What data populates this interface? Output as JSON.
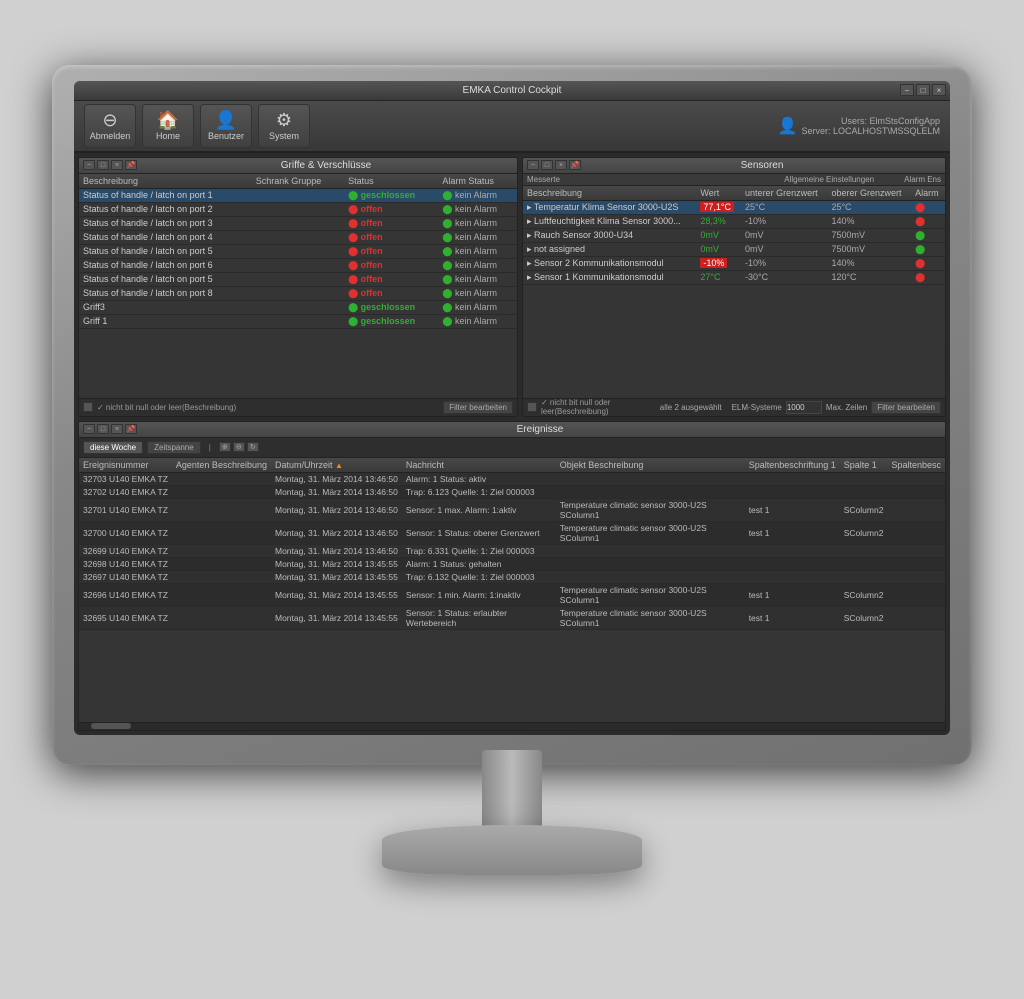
{
  "app": {
    "title": "EMKA Control Cockpit",
    "window_controls": [
      "-",
      "□",
      "×"
    ]
  },
  "toolbar": {
    "buttons": [
      {
        "label": "Abmelden",
        "icon": "⊖"
      },
      {
        "label": "Home",
        "icon": "🏠"
      },
      {
        "label": "Benutzer",
        "icon": "👤"
      },
      {
        "label": "System",
        "icon": "⚙"
      }
    ],
    "user": {
      "name": "Users: ElmStsConfigApp",
      "server": "Server: LOCALHOST\\MSSQLELM"
    }
  },
  "griffe_panel": {
    "title": "Griffe & Verschlüsse",
    "columns": [
      "Beschreibung",
      "Schrank Gruppe",
      "Status",
      "Alarm Status"
    ],
    "rows": [
      {
        "beschreibung": "Status of handle / latch on port 1",
        "status": "geschlossen",
        "status_type": "green",
        "alarm": "kein Alarm",
        "alarm_type": "green"
      },
      {
        "beschreibung": "Status of handle / latch on port 2",
        "status": "offen",
        "status_type": "red",
        "alarm": "kein Alarm",
        "alarm_type": "green"
      },
      {
        "beschreibung": "Status of handle / latch on port 3",
        "status": "offen",
        "status_type": "red",
        "alarm": "kein Alarm",
        "alarm_type": "green"
      },
      {
        "beschreibung": "Status of handle / latch on port 4",
        "status": "offen",
        "status_type": "red",
        "alarm": "kein Alarm",
        "alarm_type": "green"
      },
      {
        "beschreibung": "Status of handle / latch on port 5",
        "status": "offen",
        "status_type": "red",
        "alarm": "kein Alarm",
        "alarm_type": "green"
      },
      {
        "beschreibung": "Status of handle / latch on port 6",
        "status": "offen",
        "status_type": "red",
        "alarm": "kein Alarm",
        "alarm_type": "green"
      },
      {
        "beschreibung": "Status of handle / latch on port 5",
        "status": "offen",
        "status_type": "red",
        "alarm": "kein Alarm",
        "alarm_type": "green"
      },
      {
        "beschreibung": "Status of handle / latch on port 8",
        "status": "offen",
        "status_type": "red",
        "alarm": "kein Alarm",
        "alarm_type": "green"
      },
      {
        "beschreibung": "Griff3",
        "status": "geschlossen",
        "status_type": "green",
        "alarm": "kein Alarm",
        "alarm_type": "green"
      },
      {
        "beschreibung": "Griff 1",
        "status": "geschlossen",
        "status_type": "green",
        "alarm": "kein Alarm",
        "alarm_type": "green"
      }
    ],
    "footer_text": "✓ nicht bit null oder leer(Beschreibung)",
    "filter_btn": "Filter bearbeiten"
  },
  "sensoren_panel": {
    "title": "Sensoren",
    "general_settings": "Allgemeine Einstellungen",
    "alarm_ens": "Alarm Ens",
    "columns": [
      "Beschreibung",
      "Wert",
      "unterer Grenzwert",
      "oberer Grenzwert",
      "Alarm"
    ],
    "rows": [
      {
        "beschreibung": "Temperatur Klima Sensor 3000-U2S",
        "wert": "77,1°C",
        "wert_type": "red",
        "unterer": "25°C",
        "oberer": "25°C",
        "alarm_dot": "red"
      },
      {
        "beschreibung": "Luftfeuchtigkeit Klima Sensor 3000...",
        "wert": "28,3%",
        "wert_type": "normal",
        "unterer": "-10%",
        "oberer": "140%",
        "alarm_dot": "red"
      },
      {
        "beschreibung": "Rauch Sensor 3000-U34",
        "wert": "0mV",
        "wert_type": "normal",
        "unterer": "0mV",
        "oberer": "7500mV",
        "alarm_dot": "green"
      },
      {
        "beschreibung": "not assigned",
        "wert": "0mV",
        "wert_type": "normal",
        "unterer": "0mV",
        "oberer": "7500mV",
        "alarm_dot": "green"
      },
      {
        "beschreibung": "Sensor 2 Kommunikationsmodul",
        "wert": "-10%",
        "wert_type": "red",
        "unterer": "-10%",
        "oberer": "140%",
        "alarm_dot": "red"
      },
      {
        "beschreibung": "Sensor 1 Kommunikationsmodul",
        "wert": "27°C",
        "wert_type": "normal",
        "unterer": "-30°C",
        "oberer": "120°C",
        "alarm_dot": "red"
      }
    ],
    "footer_text": "✓ nicht bit null oder leer(Beschreibung)",
    "filter_btn": "Filter bearbeiten",
    "summary": "alle 2 ausgewählt",
    "elm_system": "ELM-Systeme",
    "elm_value": "1000",
    "max_zeilen": "Max. Zeilen"
  },
  "ereignisse_panel": {
    "title": "Ereignisse",
    "toolbar": {
      "btn1": "diese Woche",
      "btn2": "Zeitspanne"
    },
    "columns": [
      "Ereignisnummer",
      "Agenten Beschreibung",
      "Datum/Uhrzeit",
      "▲ Nachricht",
      "Objekt Beschreibung",
      "Spaltenbeschriftung 1",
      "Spalte 1",
      "Spaltenbesc"
    ],
    "rows": [
      {
        "nr": "32703 U140 EMKA TZ",
        "datum": "Montag, 31. März 2014 13:46:50",
        "nachricht": "Alarm: 1 Status: aktiv",
        "objekt": "",
        "sp1": "",
        "s1": "",
        "spb": ""
      },
      {
        "nr": "32702 U140 EMKA TZ",
        "datum": "Montag, 31. März 2014 13:46:50",
        "nachricht": "Trap: 6.123 Quelle: 1: Ziel 000003",
        "objekt": "",
        "sp1": "",
        "s1": "",
        "spb": ""
      },
      {
        "nr": "32701 U140 EMKA TZ",
        "datum": "Montag, 31. März 2014 13:46:50",
        "nachricht": "Sensor: 1 max. Alarm: 1:aktiv",
        "objekt": "Temperature climatic sensor 3000-U2S SColumn1",
        "sp1": "test 1",
        "s1": "SColumn2",
        "spb": ""
      },
      {
        "nr": "32700 U140 EMKA TZ",
        "datum": "Montag, 31. März 2014 13:46:50",
        "nachricht": "Sensor: 1 Status: oberer Grenzwert",
        "objekt": "Temperature climatic sensor 3000-U2S SColumn1",
        "sp1": "test 1",
        "s1": "SColumn2",
        "spb": ""
      },
      {
        "nr": "32699 U140 EMKA TZ",
        "datum": "Montag, 31. März 2014 13:46:50",
        "nachricht": "Trap: 6.331 Quelle: 1: Ziel 000003",
        "objekt": "",
        "sp1": "",
        "s1": "",
        "spb": ""
      },
      {
        "nr": "32698 U140 EMKA TZ",
        "datum": "Montag, 31. März 2014 13:45:55",
        "nachricht": "Alarm: 1 Status: gehalten",
        "objekt": "",
        "sp1": "",
        "s1": "",
        "spb": ""
      },
      {
        "nr": "32697 U140 EMKA TZ",
        "datum": "Montag, 31. März 2014 13:45:55",
        "nachricht": "Trap: 6.132 Quelle: 1: Ziel 000003",
        "objekt": "",
        "sp1": "",
        "s1": "",
        "spb": ""
      },
      {
        "nr": "32696 U140 EMKA TZ",
        "datum": "Montag, 31. März 2014 13:45:55",
        "nachricht": "Sensor: 1 min. Alarm: 1:inaktiv",
        "objekt": "Temperature climatic sensor 3000-U2S SColumn1",
        "sp1": "test 1",
        "s1": "SColumn2",
        "spb": ""
      },
      {
        "nr": "32695 U140 EMKA TZ",
        "datum": "Montag, 31. März 2014 13:45:55",
        "nachricht": "Sensor: 1 Status: erlaubter Wertebereich",
        "objekt": "Temperature climatic sensor 3000-U2S SColumn1",
        "sp1": "test 1",
        "s1": "SColumn2",
        "spb": ""
      }
    ]
  }
}
